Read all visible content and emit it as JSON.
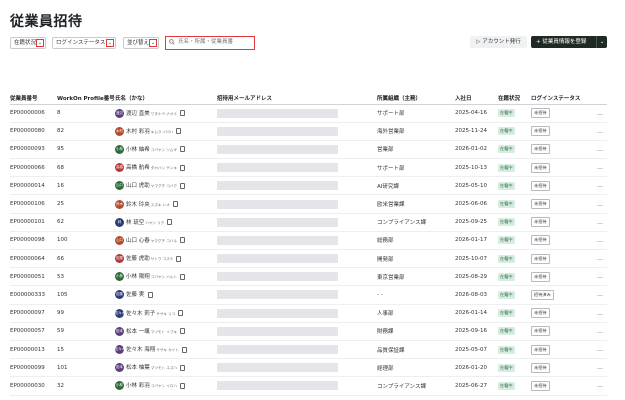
{
  "page": {
    "title": "従業員招待"
  },
  "filters": [
    {
      "label": "在籍状況"
    },
    {
      "label": "ログインステータス"
    },
    {
      "label": "並び替え"
    }
  ],
  "search": {
    "placeholder": "氏名・所属・従業員番"
  },
  "actions": {
    "issue_account": "アカウント発行",
    "register": "+ 従業員情報を登録"
  },
  "columns": [
    "従業員番号",
    "WorkOn Profile番号",
    "氏名（かな）",
    "招待用メールアドレス",
    "所属組織（主務）",
    "入社日",
    "在籍状況",
    "ログインステータス"
  ],
  "rows": [
    {
      "id": "EP00000006",
      "profile": "8",
      "avatar": "渡辺",
      "color": "#5b3f7a",
      "name": "渡辺 直美",
      "kana": "ワタナベ ナオミ",
      "dept": "サポート部",
      "date": "2025-04-16",
      "status": "在籍中",
      "login": "未招待"
    },
    {
      "id": "EP00000080",
      "profile": "82",
      "avatar": "木村",
      "color": "#b24a2c",
      "name": "木村 彩羽",
      "kana": "キムラ イロハ",
      "dept": "海外営業部",
      "date": "2025-11-24",
      "status": "在籍中",
      "login": "未招待"
    },
    {
      "id": "EP00000093",
      "profile": "95",
      "avatar": "小林",
      "color": "#2f6b3a",
      "name": "小林 紬希",
      "kana": "コバヤシ ツムギ",
      "dept": "営業部",
      "date": "2026-01-02",
      "status": "在籍中",
      "login": "未招待"
    },
    {
      "id": "EP00000066",
      "profile": "68",
      "avatar": "高橋",
      "color": "#b23a3a",
      "name": "高橋 航希",
      "kana": "タカハシ ゲンキ",
      "dept": "サポート部",
      "date": "2025-10-13",
      "status": "在籍中",
      "login": "未招待"
    },
    {
      "id": "EP00000014",
      "profile": "16",
      "avatar": "山口",
      "color": "#2f6b3a",
      "name": "山口 虎助",
      "kana": "ヤマグチ コハク",
      "dept": "AI研究課",
      "date": "2025-05-10",
      "status": "在籍中",
      "login": "未招待"
    },
    {
      "id": "EP00000106",
      "profile": "25",
      "avatar": "鈴木",
      "color": "#b24a2c",
      "name": "鈴木 玲央",
      "kana": "スズキ レオ",
      "dept": "欧米営業課",
      "date": "2025-06-06",
      "status": "在籍中",
      "login": "未招待"
    },
    {
      "id": "EP00000101",
      "profile": "62",
      "avatar": "林",
      "color": "#2c3e7a",
      "name": "林 琉空",
      "kana": "ハヤシ リク",
      "dept": "コンプライアンス課",
      "date": "2025-09-25",
      "status": "在籍中",
      "login": "未招待"
    },
    {
      "id": "EP00000098",
      "profile": "100",
      "avatar": "山口",
      "color": "#b24a2c",
      "name": "山口 心春",
      "kana": "ヤマグチ コハル",
      "dept": "総務部",
      "date": "2026-01-17",
      "status": "在籍中",
      "login": "未招待"
    },
    {
      "id": "EP00000064",
      "profile": "66",
      "avatar": "佐藤",
      "color": "#b23a3a",
      "name": "佐藤 虎助",
      "kana": "サトウ コスケ",
      "dept": "開発部",
      "date": "2025-10-07",
      "status": "在籍中",
      "login": "未招待"
    },
    {
      "id": "EP00000051",
      "profile": "53",
      "avatar": "小林",
      "color": "#2f6b3a",
      "name": "小林 陽翔",
      "kana": "コバヤシ ハルト",
      "dept": "東京営業部",
      "date": "2025-08-29",
      "status": "在籍中",
      "login": "未招待"
    },
    {
      "id": "E000000333",
      "profile": "105",
      "avatar": "佐藤",
      "color": "#2c3e7a",
      "name": "佐藤 実",
      "kana": "",
      "dept": "- -",
      "date": "2026-08-03",
      "status": "在籍中",
      "login": "招待済み"
    },
    {
      "id": "EP00000097",
      "profile": "99",
      "avatar": "佐々木",
      "color": "#2c3e7a",
      "name": "佐々木 莉子",
      "kana": "ササキ リコ",
      "dept": "人事部",
      "date": "2026-01-14",
      "status": "在籍中",
      "login": "未招待"
    },
    {
      "id": "EP00000057",
      "profile": "59",
      "avatar": "松本",
      "color": "#5b3f7a",
      "name": "松本 一颯",
      "kana": "マツモト イブキ",
      "dept": "財務課",
      "date": "2025-09-16",
      "status": "在籍中",
      "login": "未招待"
    },
    {
      "id": "EP00000013",
      "profile": "15",
      "avatar": "佐々木",
      "color": "#5b3f7a",
      "name": "佐々木 海翔",
      "kana": "ササキ カイト",
      "dept": "品質保証課",
      "date": "2025-05-07",
      "status": "在籍中",
      "login": "未招待"
    },
    {
      "id": "EP00000099",
      "profile": "101",
      "avatar": "松本",
      "color": "#5b3f7a",
      "name": "松本 柚葉",
      "kana": "マツモト ユズハ",
      "dept": "経理部",
      "date": "2026-01-20",
      "status": "在籍中",
      "login": "未招待"
    },
    {
      "id": "EP00000030",
      "profile": "32",
      "avatar": "小林",
      "color": "#2f6b3a",
      "name": "小林 彩羽",
      "kana": "コバヤシ イロハ",
      "dept": "コンプライアンス課",
      "date": "2025-06-27",
      "status": "在籍中",
      "login": "未招待"
    }
  ],
  "row_more": "…"
}
